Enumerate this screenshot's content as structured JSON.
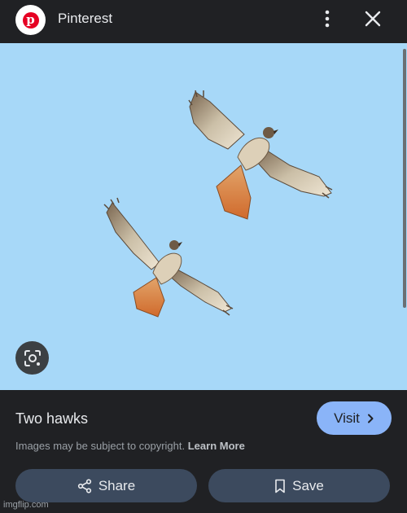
{
  "header": {
    "source_name": "Pinterest",
    "logo_letter": "p",
    "icons": {
      "logo": "pinterest-logo-icon",
      "more": "more-vert-icon",
      "close": "close-icon"
    }
  },
  "image": {
    "subject": "two red-tailed hawks soaring against a blue sky",
    "sky_color": "#a7d8f8"
  },
  "lens": {
    "icon": "lens-icon"
  },
  "details": {
    "title": "Two hawks",
    "visit_label": "Visit",
    "copyright_text": "Images may be subject to copyright.",
    "learn_more": "Learn More",
    "share_label": "Share",
    "save_label": "Save",
    "accent_color": "#8ab4f8"
  },
  "watermark": "imgflip.com"
}
